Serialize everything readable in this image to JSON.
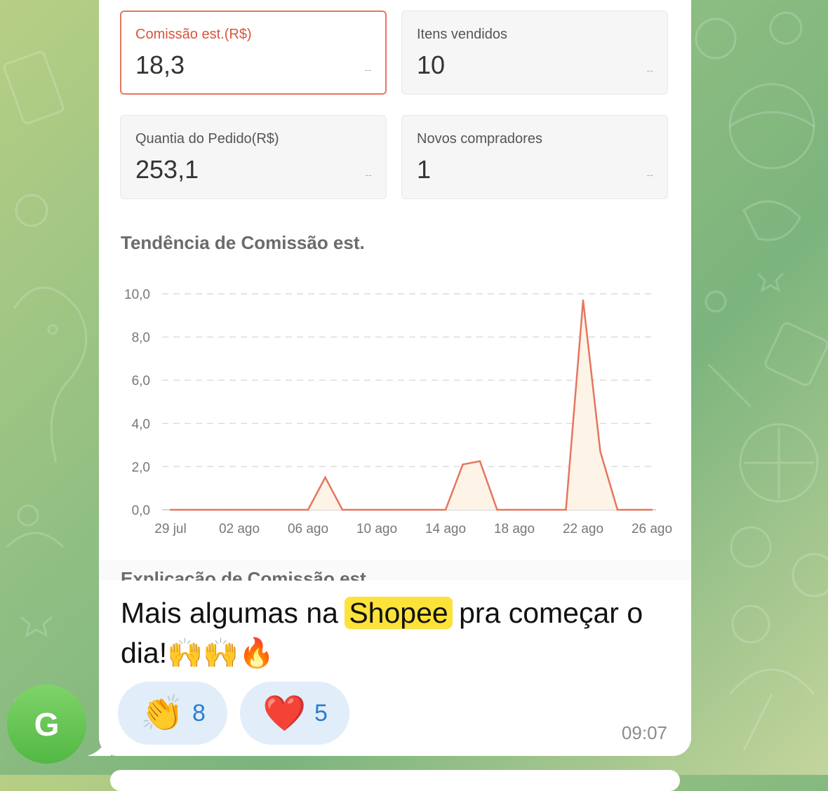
{
  "cards": [
    {
      "label": "Comissão est.(R$)",
      "value": "18,3",
      "trend": "--",
      "active": true
    },
    {
      "label": "Itens vendidos",
      "value": "10",
      "trend": "--",
      "active": false
    },
    {
      "label": "Quantia do Pedido(R$)",
      "value": "253,1",
      "trend": "--",
      "active": false
    },
    {
      "label": "Novos compradores",
      "value": "1",
      "trend": "--",
      "active": false
    }
  ],
  "chart_title": "Tendência de Comissão est.",
  "chart_data": {
    "type": "area",
    "title": "Tendência de Comissão est.",
    "xlabel": "",
    "ylabel": "",
    "ylim": [
      0,
      10
    ],
    "y_ticks": [
      "0,0",
      "2,0",
      "4,0",
      "6,0",
      "8,0",
      "10,0"
    ],
    "x_tick_labels": [
      "29 jul",
      "02 ago",
      "06 ago",
      "10 ago",
      "14 ago",
      "18 ago",
      "22 ago",
      "26 ago"
    ],
    "grid": true,
    "color": "#e5765f",
    "fill_color": "#fdf3e6",
    "x": [
      "29 jul",
      "30 jul",
      "31 jul",
      "01 ago",
      "02 ago",
      "03 ago",
      "04 ago",
      "05 ago",
      "06 ago",
      "07 ago",
      "08 ago",
      "09 ago",
      "10 ago",
      "11 ago",
      "12 ago",
      "13 ago",
      "14 ago",
      "15 ago",
      "16 ago",
      "17 ago",
      "18 ago",
      "19 ago",
      "20 ago",
      "21 ago",
      "22 ago",
      "23 ago",
      "24 ago",
      "25 ago",
      "26 ago"
    ],
    "values": [
      0,
      0,
      0,
      0,
      0,
      0,
      0,
      0,
      0,
      1.5,
      0,
      0,
      0,
      0,
      0,
      0,
      0,
      2.1,
      2.25,
      0,
      0,
      0,
      0,
      0,
      9.7,
      2.7,
      0,
      0,
      0
    ]
  },
  "explanation_heading": "Explicação de Comissão est.",
  "message": {
    "text_before": "Mais algumas na ",
    "highlight": "Shopee",
    "text_after": " pra começar o dia!🙌🙌🔥",
    "time": "09:07"
  },
  "reactions": [
    {
      "emoji": "👏",
      "count": "8"
    },
    {
      "emoji": "❤️",
      "count": "5"
    }
  ],
  "avatar": {
    "letter": "G",
    "color": "#5cbd4b"
  }
}
